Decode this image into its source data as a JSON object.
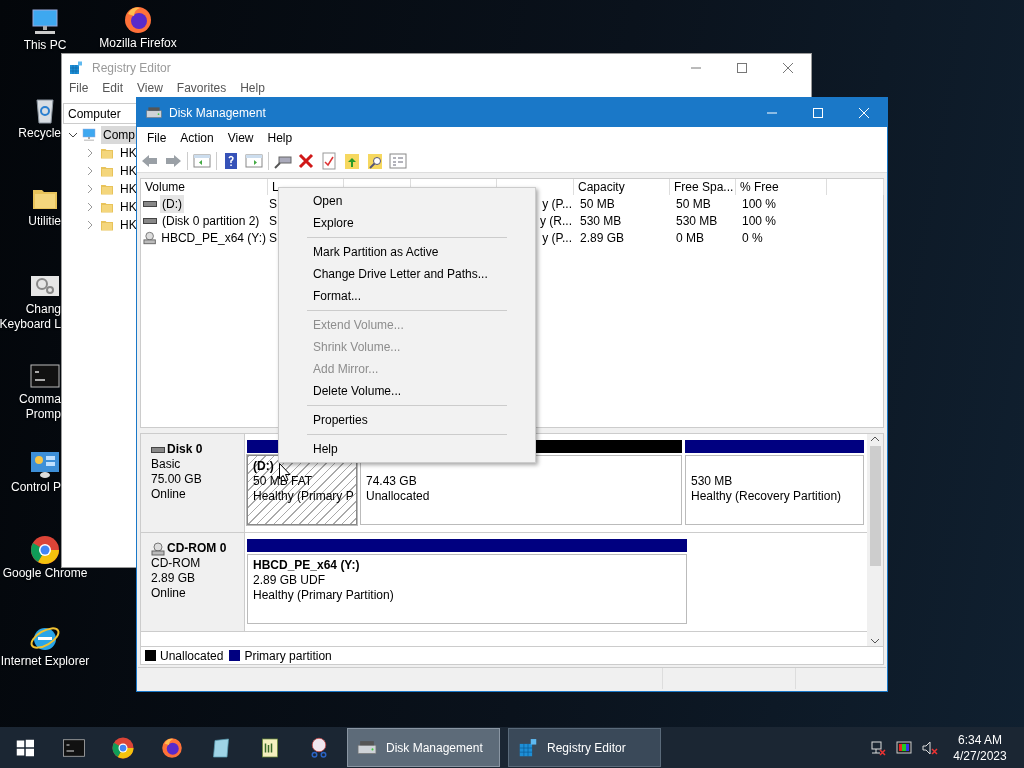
{
  "desktop": {
    "icons": [
      {
        "kind": "computer",
        "lines": [
          "This PC"
        ]
      },
      {
        "kind": "firefox",
        "lines": [
          "Mozilla Firefox"
        ]
      },
      {
        "kind": "recycle-bin",
        "lines": [
          "Recycle"
        ]
      },
      {
        "kind": "folder",
        "lines": [
          "Utilitie"
        ]
      },
      {
        "kind": "gears",
        "lines": [
          "Chang",
          "Keyboard L"
        ]
      },
      {
        "kind": "terminal",
        "lines": [
          "Comma",
          "Promp"
        ]
      },
      {
        "kind": "control-panel",
        "lines": [
          "Control P"
        ]
      },
      {
        "kind": "chrome",
        "lines": [
          "Google Chrome"
        ]
      },
      {
        "kind": "ie",
        "lines": [
          "Internet Explorer"
        ]
      }
    ]
  },
  "registry_editor": {
    "title": "Registry Editor",
    "active": false,
    "menu": [
      "File",
      "Edit",
      "View",
      "Favorites",
      "Help"
    ],
    "address": "Computer",
    "tree": [
      {
        "label": "Comp",
        "expanded": true,
        "selected": true,
        "children": [
          {
            "label": "HK",
            "expanded": false
          },
          {
            "label": "HK",
            "expanded": false
          },
          {
            "label": "HK",
            "expanded": false
          },
          {
            "label": "HK",
            "expanded": false
          },
          {
            "label": "HK",
            "expanded": false
          }
        ]
      }
    ]
  },
  "disk_management": {
    "title": "Disk Management",
    "active": true,
    "menu": [
      "File",
      "Action",
      "View",
      "Help"
    ],
    "volume_table": {
      "columns": {
        "volume": "Volume",
        "layout": "L",
        "capacity": "Capacity",
        "free_space": "Free Spa...",
        "percent_free": "% Free"
      },
      "rows": [
        {
          "kind": "disk",
          "selected": true,
          "volume": "(D:)",
          "layout": "S",
          "status": "y (P...",
          "capacity": "50 MB",
          "free_space": "50 MB",
          "percent_free": "100 %"
        },
        {
          "kind": "disk",
          "selected": false,
          "volume": "(Disk 0 partition 2)",
          "layout": "S",
          "status": "y (R...",
          "capacity": "530 MB",
          "free_space": "530 MB",
          "percent_free": "100 %"
        },
        {
          "kind": "cdrom",
          "selected": false,
          "volume": "HBCD_PE_x64 (Y:)",
          "layout": "S",
          "status": "y (P...",
          "capacity": "2.89 GB",
          "free_space": "0 MB",
          "percent_free": "0 %"
        }
      ]
    },
    "disks": [
      {
        "kind": "disk",
        "name": "Disk 0",
        "lines": [
          "Basic",
          "75.00 GB",
          "Online"
        ],
        "partitions": [
          {
            "kind": "primary",
            "selected": true,
            "title": "(D:)",
            "lines": [
              "50 MB FAT",
              "Healthy (Primary P"
            ]
          },
          {
            "kind": "unallocated",
            "selected": false,
            "lines": [
              "74.43 GB",
              "Unallocated"
            ]
          },
          {
            "kind": "primary",
            "selected": false,
            "lines": [
              "530 MB",
              "Healthy (Recovery Partition)"
            ]
          }
        ]
      },
      {
        "kind": "cdrom",
        "name": "CD-ROM 0",
        "lines": [
          "CD-ROM",
          "2.89 GB",
          "Online"
        ],
        "partitions": [
          {
            "kind": "primary",
            "selected": false,
            "title": "HBCD_PE_x64  (Y:)",
            "lines": [
              "2.89 GB UDF",
              "Healthy (Primary Partition)"
            ]
          }
        ]
      }
    ],
    "legend": [
      {
        "label": "Unallocated",
        "color": "#000000"
      },
      {
        "label": "Primary partition",
        "color": "#000080"
      }
    ]
  },
  "context_menu": {
    "items": [
      {
        "kind": "item",
        "label": "Open",
        "disabled": false
      },
      {
        "kind": "item",
        "label": "Explore",
        "disabled": false
      },
      {
        "kind": "separator"
      },
      {
        "kind": "item",
        "label": "Mark Partition as Active",
        "disabled": false
      },
      {
        "kind": "item",
        "label": "Change Drive Letter and Paths...",
        "disabled": false
      },
      {
        "kind": "item",
        "label": "Format...",
        "disabled": false
      },
      {
        "kind": "separator"
      },
      {
        "kind": "item",
        "label": "Extend Volume...",
        "disabled": true
      },
      {
        "kind": "item",
        "label": "Shrink Volume...",
        "disabled": true
      },
      {
        "kind": "item",
        "label": "Add Mirror...",
        "disabled": true
      },
      {
        "kind": "item",
        "label": "Delete Volume...",
        "disabled": false
      },
      {
        "kind": "separator"
      },
      {
        "kind": "item",
        "label": "Properties",
        "disabled": false
      },
      {
        "kind": "separator"
      },
      {
        "kind": "item",
        "label": "Help",
        "disabled": false
      }
    ]
  },
  "taskbar": {
    "pinned": [
      {
        "kind": "start"
      },
      {
        "kind": "terminal"
      },
      {
        "kind": "chrome"
      },
      {
        "kind": "firefox"
      },
      {
        "kind": "notes"
      },
      {
        "kind": "notepad"
      },
      {
        "kind": "tool"
      }
    ],
    "windows": [
      {
        "kind": "disk",
        "label": "Disk Management",
        "selected": true
      },
      {
        "kind": "registry",
        "label": "Registry Editor",
        "selected": false
      }
    ],
    "time": "6:34 AM",
    "date": "4/27/2023"
  }
}
